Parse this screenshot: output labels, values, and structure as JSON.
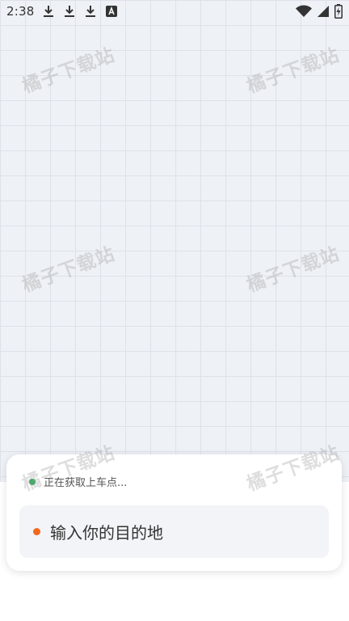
{
  "status_bar": {
    "time": "2:38",
    "left_icons": [
      "download-icon",
      "download-icon",
      "download-icon",
      "a-box-icon"
    ],
    "right_icons": [
      "wifi-icon",
      "signal-icon",
      "battery-icon"
    ]
  },
  "watermark": {
    "text": "橘子下载站"
  },
  "ride_panel": {
    "pickup_status": "正在获取上车点...",
    "destination_placeholder": "输入你的目的地"
  },
  "colors": {
    "map_background": "#eef1f6",
    "grid_line": "#dde2ea",
    "pickup_dot": "#2eab5a",
    "destination_dot": "#f0691e"
  }
}
